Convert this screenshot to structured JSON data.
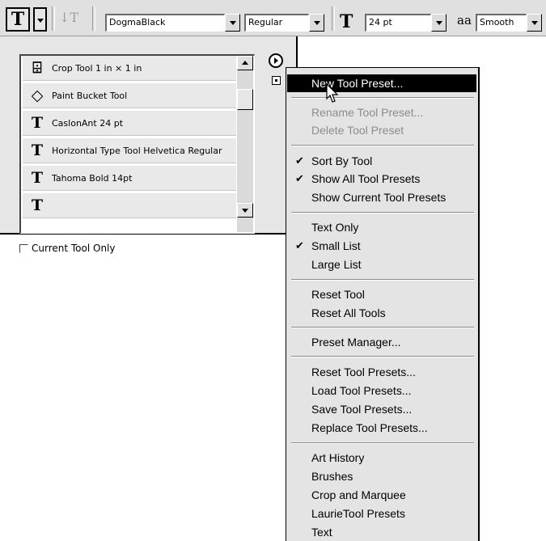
{
  "toolbar": {
    "tool_icon_glyph": "T",
    "orientation_icon_glyph": "↓T",
    "font_family": "DogmaBlack",
    "font_style": "Regular",
    "font_size_icon_glyph": "T",
    "font_size": "24 pt",
    "antialias_icon_glyph": "aa",
    "antialias": "Smooth"
  },
  "presets_panel": {
    "items": [
      {
        "icon": "crop-icon",
        "glyph": "⌹",
        "label": "Crop Tool 1 in × 1 in"
      },
      {
        "icon": "paint-bucket-icon",
        "glyph": "◇",
        "label": "Paint Bucket Tool"
      },
      {
        "icon": "type-icon",
        "glyph": "T",
        "label": "CaslonAnt 24 pt"
      },
      {
        "icon": "type-icon",
        "glyph": "T",
        "label": "Horizontal Type Tool Helvetica Regular"
      },
      {
        "icon": "type-icon",
        "glyph": "T",
        "label": "Tahoma Bold 14pt"
      },
      {
        "icon": "type-icon",
        "glyph": "T",
        "label": ""
      }
    ],
    "current_tool_only_label": "Current Tool Only",
    "current_tool_only_checked": false
  },
  "menu": {
    "items": [
      {
        "label": "New Tool Preset...",
        "highlighted": true
      },
      {
        "label": "Rename Tool Preset...",
        "disabled": true
      },
      {
        "label": "Delete Tool Preset",
        "disabled": true
      },
      {
        "label": "Sort By Tool",
        "checked": true
      },
      {
        "label": "Show All Tool Presets",
        "checked": true
      },
      {
        "label": "Show Current Tool Presets"
      },
      {
        "label": "Text Only"
      },
      {
        "label": "Small List",
        "checked": true
      },
      {
        "label": "Large List"
      },
      {
        "label": "Reset Tool"
      },
      {
        "label": "Reset All Tools"
      },
      {
        "label": "Preset Manager..."
      },
      {
        "label": "Reset Tool Presets..."
      },
      {
        "label": "Load Tool Presets..."
      },
      {
        "label": "Save Tool Presets..."
      },
      {
        "label": "Replace Tool Presets..."
      },
      {
        "label": "Art History"
      },
      {
        "label": "Brushes"
      },
      {
        "label": "Crop and Marquee"
      },
      {
        "label": "LaurieTool Presets"
      },
      {
        "label": "Text"
      }
    ],
    "check_glyph": "✔"
  },
  "colors": {
    "highlight_bg": "#000000",
    "highlight_fg": "#ffffff",
    "disabled_text": "#8c8c8c",
    "panel_bg": "#e6e6e6"
  }
}
